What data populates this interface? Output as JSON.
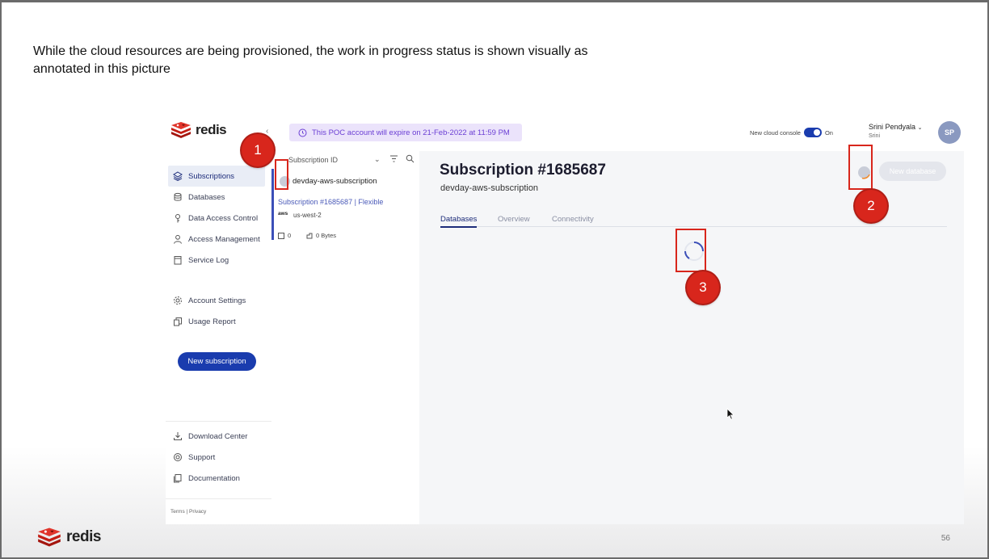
{
  "slide": {
    "caption": "While the cloud resources are being provisioned, the work in progress status is shown visually as annotated in this picture",
    "page_number": "56",
    "footer_brand": "redis"
  },
  "sidebar": {
    "brand": "redis",
    "items_top": [
      {
        "label": "Subscriptions",
        "icon": "layers-icon",
        "active": true
      },
      {
        "label": "Databases",
        "icon": "database-icon"
      },
      {
        "label": "Data Access Control",
        "icon": "key-icon"
      },
      {
        "label": "Access Management",
        "icon": "user-icon"
      },
      {
        "label": "Service Log",
        "icon": "log-icon"
      }
    ],
    "items_mid": [
      {
        "label": "Account Settings",
        "icon": "gear-icon"
      },
      {
        "label": "Usage Report",
        "icon": "report-icon"
      }
    ],
    "new_subscription": "New subscription",
    "items_bottom": [
      {
        "label": "Download Center",
        "icon": "download-icon"
      },
      {
        "label": "Support",
        "icon": "support-icon"
      },
      {
        "label": "Documentation",
        "icon": "docs-icon"
      }
    ],
    "terms": "Terms | Privacy"
  },
  "topbar": {
    "poc_banner": "This POC account will expire on 21-Feb-2022 at 11:59 PM",
    "console_label": "New cloud console",
    "console_state": "On",
    "user_name": "Srini Pendyala",
    "user_sub": "Srini",
    "avatar_initials": "SP"
  },
  "list": {
    "sort_label": "Subscription ID",
    "card": {
      "name": "devday-aws-subscription",
      "meta": "Subscription #1685687 | Flexible",
      "provider": "aws",
      "region": "us-west-2",
      "db_count": "0",
      "memory": "0 Bytes"
    }
  },
  "main": {
    "title": "Subscription #1685687",
    "subtitle": "devday-aws-subscription",
    "new_database": "New database",
    "tabs": [
      "Databases",
      "Overview",
      "Connectivity"
    ]
  },
  "annotations": [
    "1",
    "2",
    "3"
  ],
  "colors": {
    "accent": "#1a3cae",
    "annotation": "#d8261c",
    "redis": "#d8261c"
  }
}
